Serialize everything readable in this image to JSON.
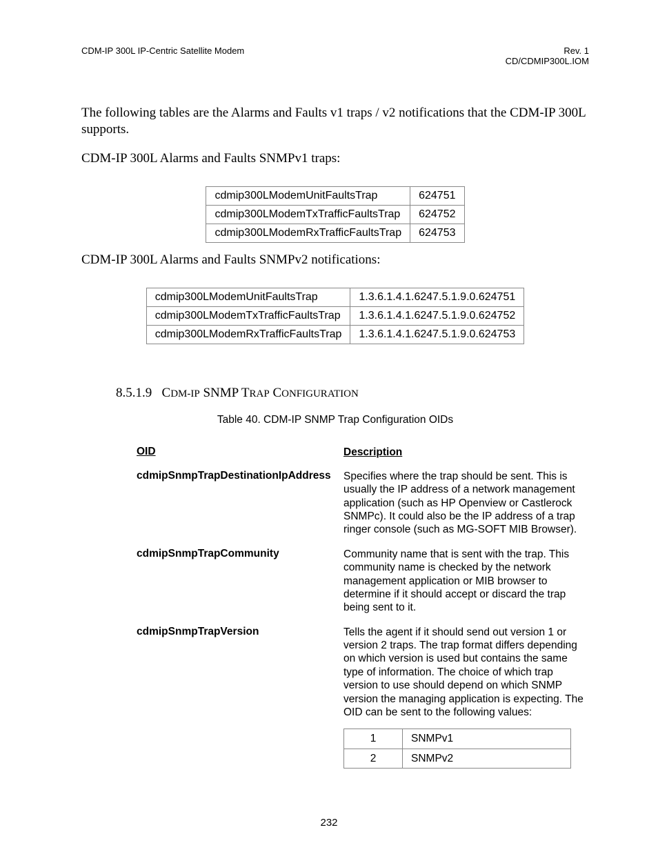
{
  "header": {
    "left": "CDM-IP 300L IP-Centric Satellite Modem",
    "right1": "Rev. 1",
    "right2": "CD/CDMIP300L.IOM"
  },
  "intro": "The following tables are the Alarms and Faults v1 traps / v2 notifications that the CDM-IP 300L supports.",
  "v1_heading": "CDM-IP 300L Alarms and Faults SNMPv1 traps:",
  "v1_rows": [
    {
      "name": "cdmip300LModemUnitFaultsTrap",
      "val": "624751"
    },
    {
      "name": "cdmip300LModemTxTrafficFaultsTrap",
      "val": "624752"
    },
    {
      "name": "cdmip300LModemRxTrafficFaultsTrap",
      "val": "624753"
    }
  ],
  "v2_heading": "CDM-IP 300L Alarms and Faults SNMPv2 notifications:",
  "v2_rows": [
    {
      "name": "cdmip300LModemUnitFaultsTrap",
      "val": "1.3.6.1.4.1.6247.5.1.9.0.624751"
    },
    {
      "name": "cdmip300LModemTxTrafficFaultsTrap",
      "val": "1.3.6.1.4.1.6247.5.1.9.0.624752"
    },
    {
      "name": "cdmip300LModemRxTrafficFaultsTrap",
      "val": "1.3.6.1.4.1.6247.5.1.9.0.624753"
    }
  ],
  "section": {
    "num": "8.5.1.9",
    "title_part1": "C",
    "title_part2": "dm-ip",
    "title_part3": " SNMP T",
    "title_part4": "rap",
    "title_part5": " C",
    "title_part6": "onfiguration",
    "caption": "Table 40. CDM-IP SNMP Trap Configuration OIDs"
  },
  "oid_header": {
    "left": "OID",
    "right": "Description"
  },
  "oids": [
    {
      "name": "cdmipSnmpTrapDestinationIpAddress",
      "desc": "Specifies where the trap should be sent. This is usually the IP address of a network management application (such as HP Openview or Castlerock SNMPc). It could also be the IP address of a trap ringer console (such as MG-SOFT MIB Browser)."
    },
    {
      "name": "cdmipSnmpTrapCommunity",
      "desc": "Community name that is sent with the trap. This community name is checked by the network management application or MIB browser to determine if it should accept or discard the trap being sent to it."
    },
    {
      "name": "cdmipSnmpTrapVersion",
      "desc": "Tells the agent if it should send out version 1 or version 2 traps. The trap format differs depending on which version is used but contains the same type of information. The choice of which trap version to use should depend on which SNMP version the managing application is expecting. The OID can be sent to the following values:"
    }
  ],
  "version_vals": [
    {
      "k": "1",
      "v": "SNMPv1"
    },
    {
      "k": "2",
      "v": "SNMPv2"
    }
  ],
  "page_number": "232"
}
